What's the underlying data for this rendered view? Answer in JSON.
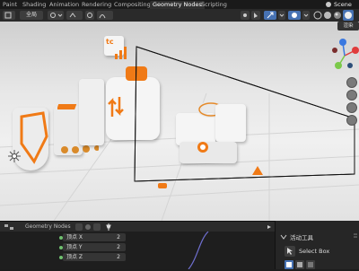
{
  "workspace_tabs": [
    "Paint",
    "Shading",
    "Animation",
    "Rendering",
    "Compositing",
    "Geometry Nodes",
    "Scripting"
  ],
  "scene_label": "Scene",
  "header": {
    "transform_orientation": "全局",
    "render_label": "渲染"
  },
  "viewport": {
    "sign_text": "tc"
  },
  "node_editor": {
    "title": "Geometry Nodes",
    "rows": [
      {
        "label": "顶点 X",
        "value": "2"
      },
      {
        "label": "顶点 Y",
        "value": "2"
      },
      {
        "label": "顶点 Z",
        "value": "2"
      }
    ]
  },
  "tool_panel": {
    "title": "活动工具",
    "tool_name": "Select Box"
  },
  "icons": {
    "gizmo_x_color": "#e03c3c",
    "gizmo_y_color": "#7bc94a",
    "gizmo_z_color": "#3a78e0",
    "accent_orange": "#f07a16"
  }
}
